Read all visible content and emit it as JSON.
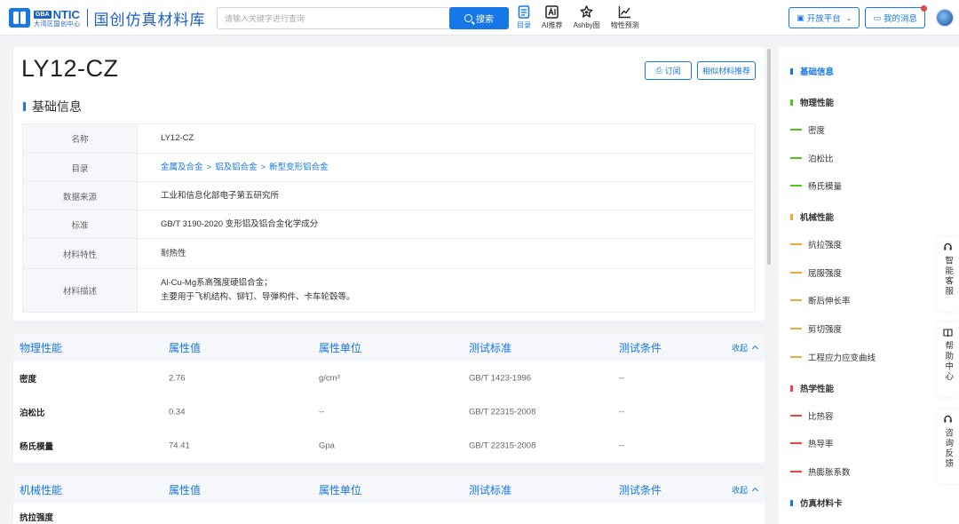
{
  "header": {
    "brand_tag": "GBA",
    "brand_name": "NTIC",
    "brand_sub": "大湾区国创中心",
    "site_title": "国创仿真材料库",
    "search_placeholder": "请输入关键字进行查询",
    "search_button": "搜索",
    "nav": [
      {
        "label": "目录",
        "icon": "catalog-icon",
        "active": true
      },
      {
        "label": "AI推荐",
        "icon": "ai-icon",
        "active": false
      },
      {
        "label": "Ashby图",
        "icon": "ashby-chart-icon",
        "active": false
      },
      {
        "label": "物性预测",
        "icon": "line-chart-icon",
        "active": false
      }
    ],
    "open_platform": "开放平台",
    "my_messages": "我的消息"
  },
  "material": {
    "title": "LY12-CZ",
    "subscribe_label": "订阅",
    "similar_label": "相似材料推荐",
    "basic_info_heading": "基础信息",
    "info": {
      "name_label": "名称",
      "name_value": "LY12-CZ",
      "catalog_label": "目录",
      "catalog_path": [
        "金属及合金",
        "铝及铝合金",
        "新型变形铝合金"
      ],
      "catalog_sep": ">",
      "source_label": "数据来源",
      "source_value": "工业和信息化部电子第五研究所",
      "standard_label": "标准",
      "standard_value": "GB/T 3190-2020 变形铝及铝合金化学成分",
      "feature_label": "材料特性",
      "feature_value": "耐热性",
      "desc_label": "材料描述",
      "desc_line1": "Al-Cu-Mg系高强度硬铝合金；",
      "desc_line2": "主要用于飞机结构、铆钉、导弹构件、卡车轮毂等。"
    }
  },
  "physical": {
    "headers": [
      "物理性能",
      "属性值",
      "属性单位",
      "测试标准",
      "测试条件"
    ],
    "collapse_label": "收起",
    "rows": [
      {
        "name": "密度",
        "value": "2.76",
        "unit": "g/cm³",
        "standard": "GB/T 1423-1996",
        "condition": "--"
      },
      {
        "name": "泊松比",
        "value": "0.34",
        "unit": "--",
        "standard": "GB/T 22315-2008",
        "condition": "--"
      },
      {
        "name": "杨氏模量",
        "value": "74.41",
        "unit": "Gpa",
        "standard": "GB/T 22315-2008",
        "condition": "--"
      }
    ]
  },
  "mechanical": {
    "headers": [
      "机械性能",
      "属性值",
      "属性单位",
      "测试标准",
      "测试条件"
    ],
    "collapse_label": "收起",
    "first_row_name": "抗拉强度"
  },
  "toc": {
    "basic": "基础信息",
    "groups": [
      {
        "title": "物理性能",
        "color": "#52c41a",
        "items": [
          "密度",
          "泊松比",
          "杨氏模量"
        ]
      },
      {
        "title": "机械性能",
        "color": "#f0a93b",
        "items": [
          "抗拉强度",
          "屈服强度",
          "断后伸长率",
          "剪切强度",
          "工程应力应变曲线"
        ]
      },
      {
        "title": "热学性能",
        "color": "#e84545",
        "items": [
          "比热容",
          "热导率",
          "热膨胀系数"
        ]
      },
      {
        "title": "仿真材料卡",
        "color": "#1677e6",
        "items": []
      }
    ]
  },
  "float_tabs": [
    "智能客服",
    "帮助中心",
    "咨询反馈"
  ],
  "colors": {
    "primary": "#1677e6",
    "physical": "#52c41a",
    "mechanical": "#f0a93b",
    "thermal": "#e84545"
  }
}
